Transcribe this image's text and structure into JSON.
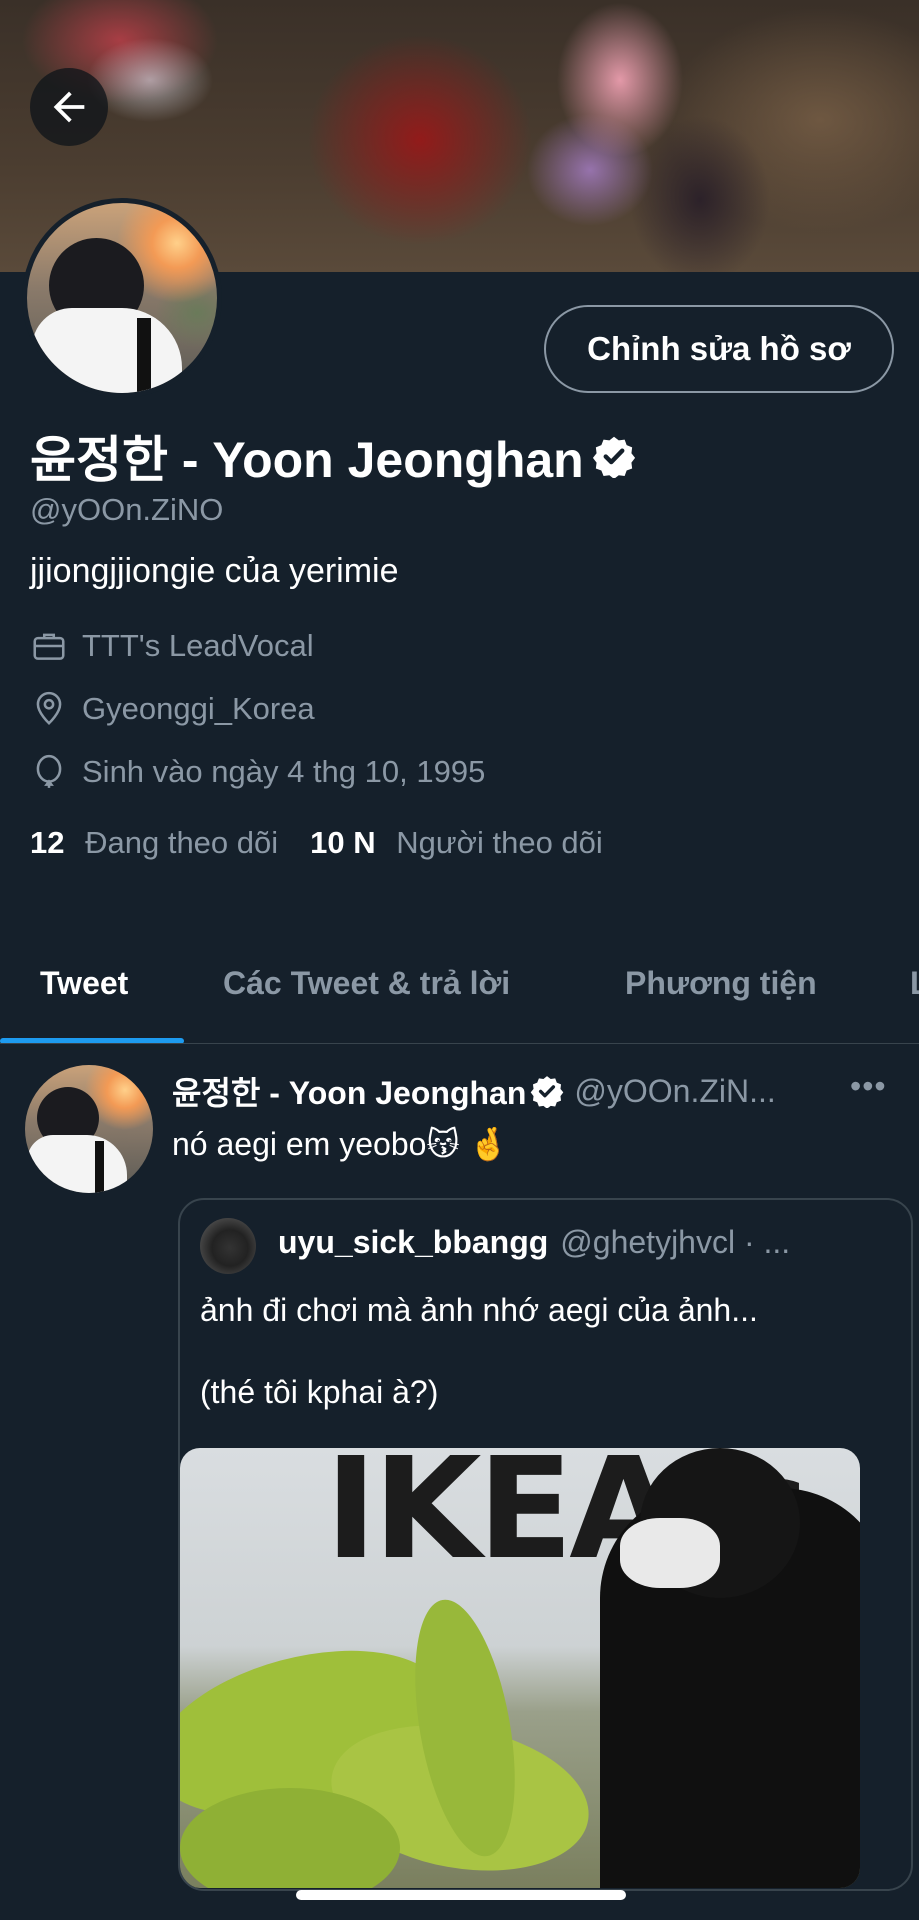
{
  "profile": {
    "edit_button": "Chỉnh sửa hồ sơ",
    "name": "윤정한 - Yoon Jeonghan",
    "handle": "@yOOn.ZiNO",
    "bio": "jjiongjjiongie của yerimie",
    "work": "TTT's LeadVocal",
    "location": "Gyeonggi_Korea",
    "birthday": "Sinh vào ngày 4 thg 10, 1995",
    "following_count": "12",
    "following_label": "Đang theo dõi",
    "followers_count": "10 N",
    "followers_label": "Người theo dõi"
  },
  "tabs": [
    {
      "label": "Tweet",
      "active": true
    },
    {
      "label": "Các Tweet & trả lời",
      "active": false
    },
    {
      "label": "Phương tiện",
      "active": false
    }
  ],
  "tweet": {
    "name": "윤정한 - Yoon Jeonghan",
    "handle": "@yOOn.ZiN...",
    "more": "•••",
    "text": "nó aegi em yeobo😽 🤞",
    "quote": {
      "name": "uyu_sick_bbangg",
      "handle": "@ghetyjhvcl · ...",
      "text1": "ảnh đi chơi mà ảnh nhớ aegi của ảnh...",
      "text2": "(thé tôi kphai à?)",
      "image_sign": "IKEA.c"
    }
  },
  "colors": {
    "background": "#15202b",
    "secondary_text": "#8b98a5",
    "accent": "#1d9bf0",
    "border": "#38444d"
  },
  "icons": [
    "back-arrow-icon",
    "verified-badge-icon",
    "briefcase-icon",
    "location-pin-icon",
    "balloon-icon"
  ]
}
